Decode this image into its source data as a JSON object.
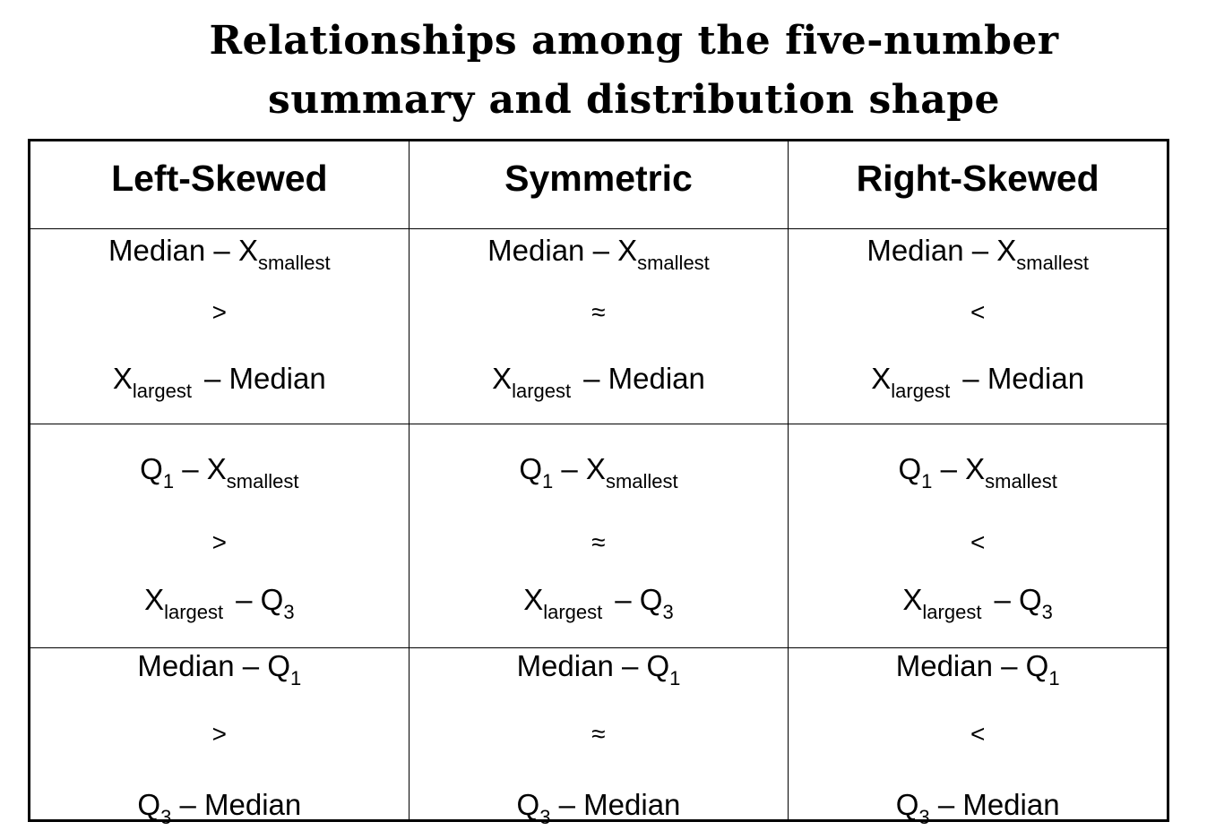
{
  "title": {
    "line1": "Relationships among the five-number",
    "line2": "summary and distribution shape"
  },
  "columns": [
    "Left-Skewed",
    "Symmetric",
    "Right-Skewed"
  ],
  "rows": [
    {
      "top": {
        "pre": "Median – X",
        "sub": "smallest",
        "post": ""
      },
      "bottom": {
        "pre": "X",
        "sub": "largest",
        "post": "– Median"
      },
      "operators": [
        ">",
        "≈",
        "<"
      ]
    },
    {
      "top": {
        "pre": "Q",
        "sub": "1",
        "post": "– X",
        "sub2": "smallest"
      },
      "bottom": {
        "pre": "X",
        "sub": "largest",
        "post": "– Q",
        "sub2": "3"
      },
      "operators": [
        ">",
        "≈",
        "<"
      ]
    },
    {
      "top": {
        "pre": "Median – Q",
        "sub": "1",
        "post": ""
      },
      "bottom": {
        "pre": "Q",
        "sub": "3",
        "post": "– Median"
      },
      "operators": [
        ">",
        "≈",
        "<"
      ]
    }
  ]
}
